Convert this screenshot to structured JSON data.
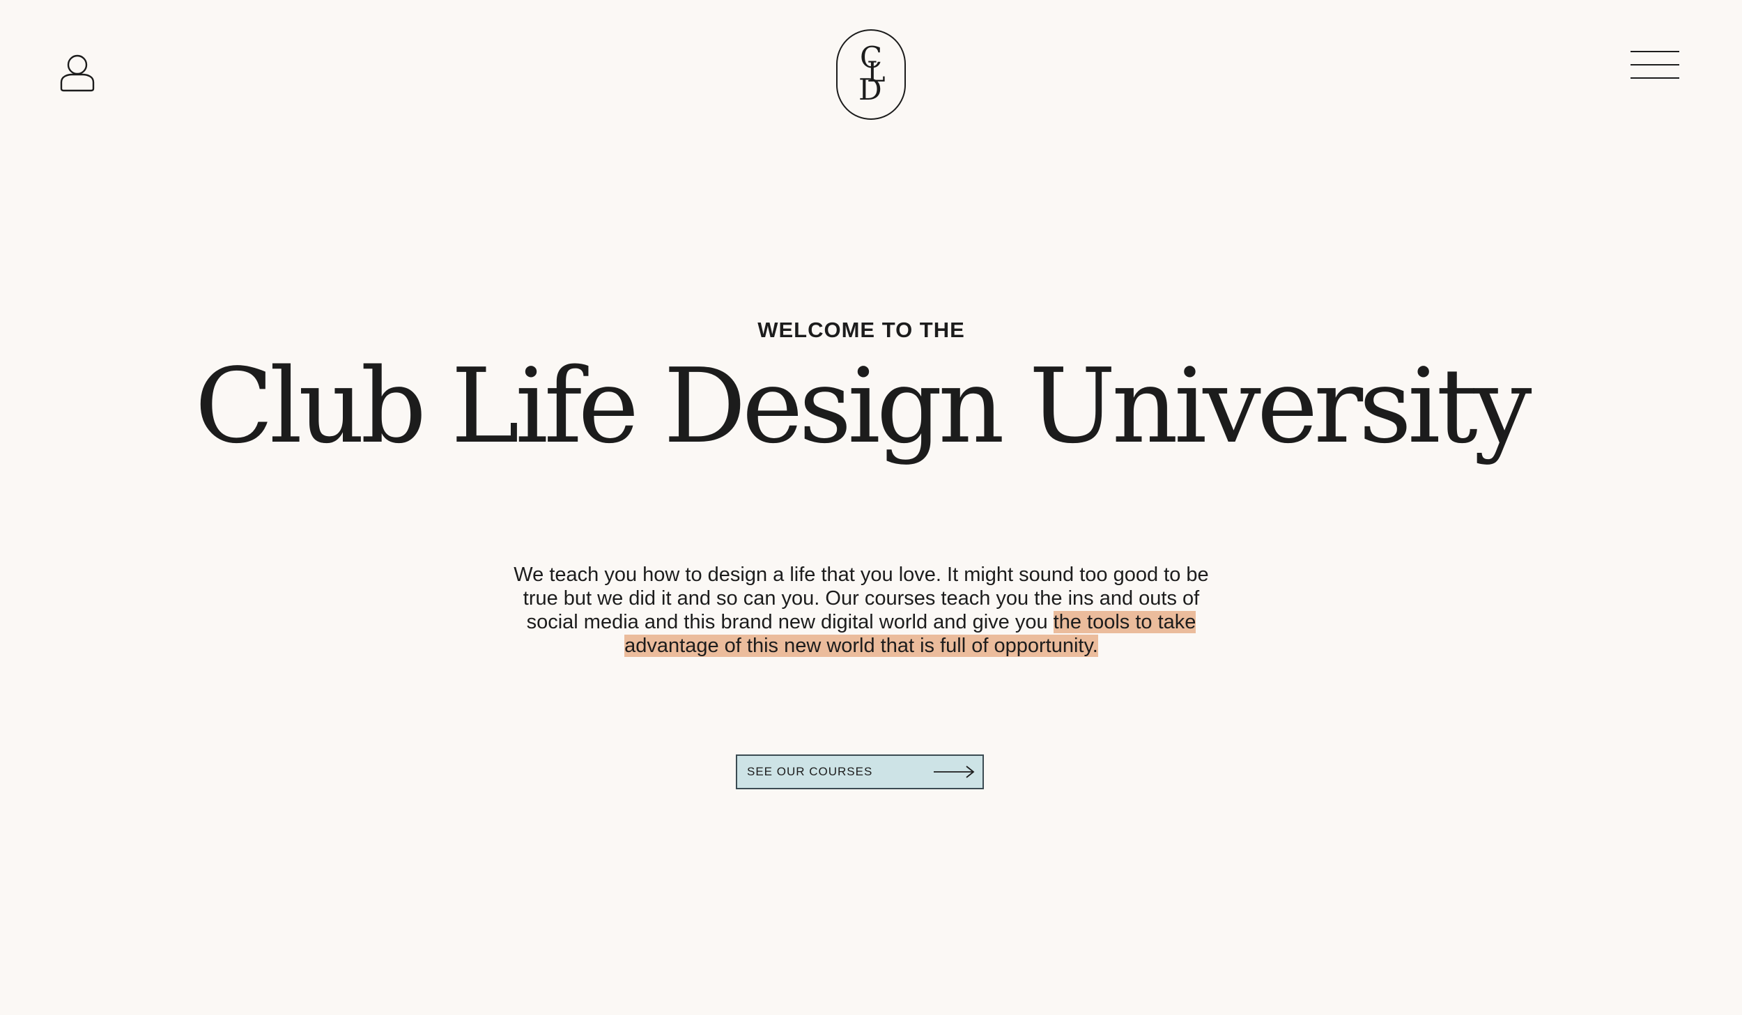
{
  "header": {
    "account_icon": "user-icon",
    "logo": {
      "letters": [
        "C",
        "L",
        "D"
      ]
    },
    "menu_icon": "hamburger-menu-icon"
  },
  "hero": {
    "eyebrow": "WELCOME TO THE",
    "title": "Club Life Design University",
    "intro_plain": "We teach you how to design a life that you love. It might sound too good to be true but we did it and so can you. Our courses teach you the ins and outs of social media and this brand new digital world and give you ",
    "intro_highlight": "the tools to take advantage of this new world that is full of opportunity.",
    "cta_label": "SEE OUR COURSES",
    "cta_icon": "arrow-right-icon"
  },
  "colors": {
    "background": "#fbf8f5",
    "text": "#1c1c1c",
    "highlight": "#ebbc9c",
    "button_bg": "#cde3e6"
  }
}
